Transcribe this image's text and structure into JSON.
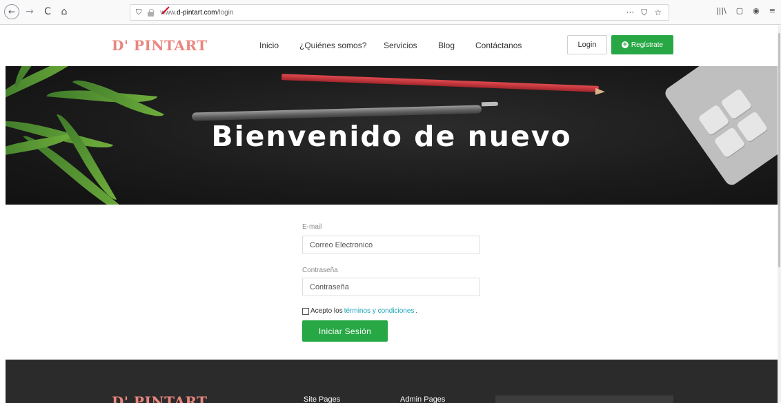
{
  "browser": {
    "url_prefix": "www.",
    "url_host": "d-pintart.com",
    "url_path": "/login",
    "back_icon": "←",
    "forward_icon": "→",
    "reload_icon": "C",
    "home_icon": "⌂",
    "shield_icon": "⛉",
    "more_icon": "···",
    "pocket_icon": "⛉",
    "star_icon": "☆",
    "library_icon": "|||\\",
    "sidebar_icon": "▢",
    "account_icon": "◉",
    "menu_icon": "≡"
  },
  "header": {
    "logo": "D' PINTART",
    "nav": [
      "Inicio",
      "¿Quiénes somos?",
      "Servicios",
      "Blog",
      "Contáctanos"
    ],
    "login_label": "Login",
    "register_label": "Regístrate",
    "register_icon": "+"
  },
  "hero": {
    "title": "Bienvenido de nuevo"
  },
  "form": {
    "email_label": "E-mail",
    "email_placeholder": "Correo Electronico",
    "password_label": "Contraseña",
    "password_placeholder": "Contraseña",
    "terms_prefix": "Acepto los ",
    "terms_link": "términos y condiciones",
    "terms_suffix": ".",
    "submit_label": "Iniciar Sesión"
  },
  "footer": {
    "logo": "D' PINTART",
    "site_pages": "Site Pages",
    "admin_pages": "Admin Pages"
  },
  "colors": {
    "brand": "#e9867f",
    "accent_green": "#28a745",
    "link_teal": "#17a2b8",
    "footer_bg": "#2b2b2b"
  }
}
